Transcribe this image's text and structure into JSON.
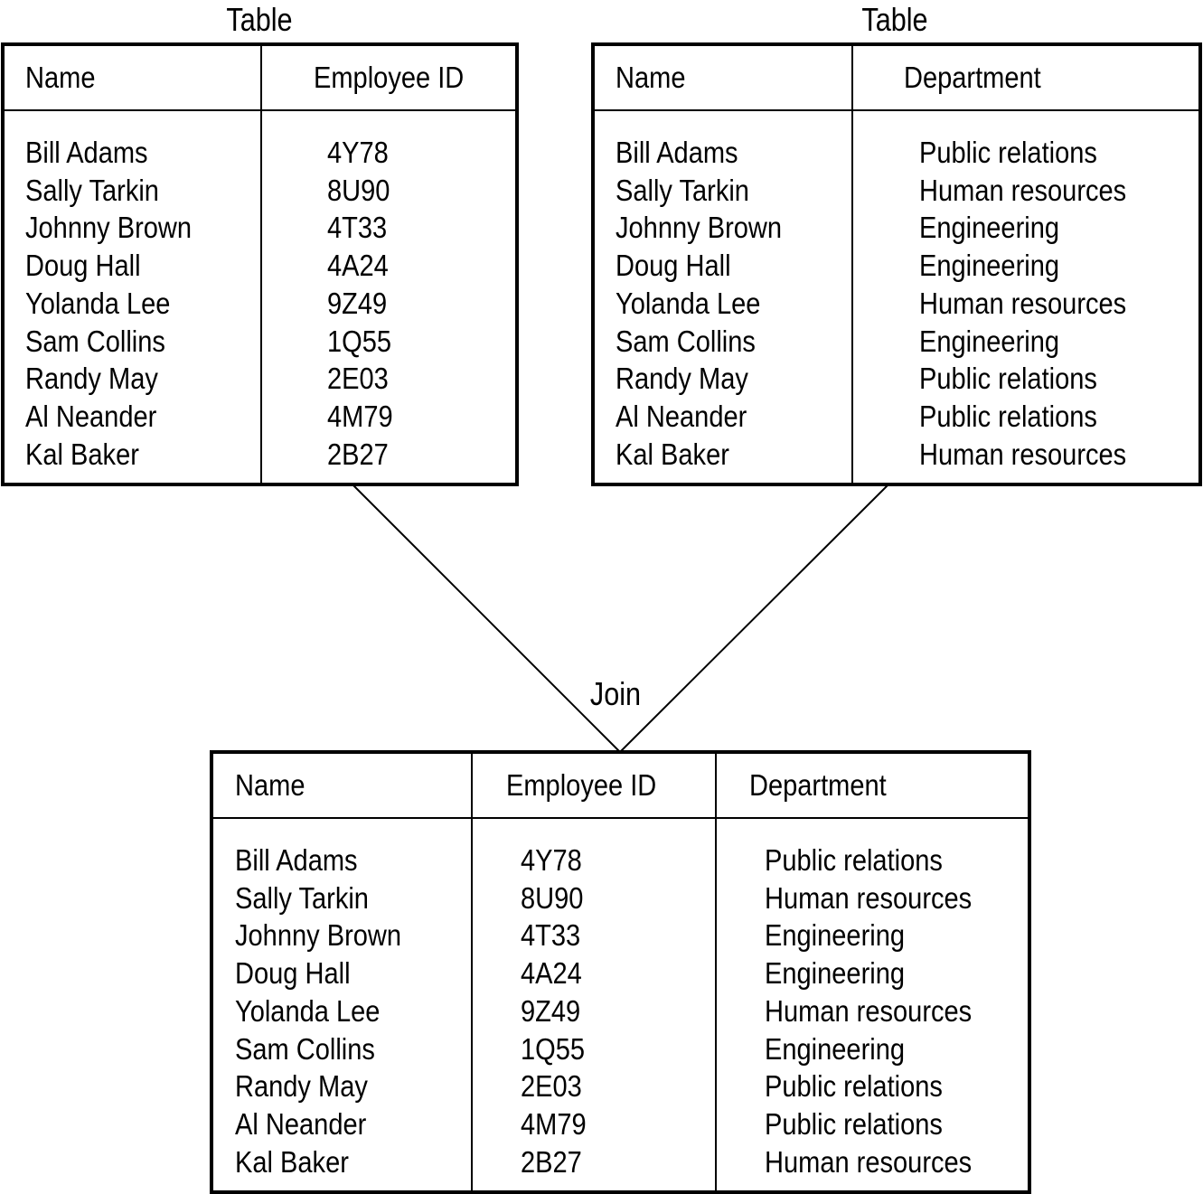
{
  "left_table": {
    "caption": "Table",
    "headers": [
      "Name",
      "Employee ID"
    ],
    "names": [
      "Bill Adams",
      "Sally Tarkin",
      "Johnny Brown",
      "Doug Hall",
      "Yolanda Lee",
      "Sam Collins",
      "Randy May",
      "Al Neander",
      "Kal Baker"
    ],
    "ids": [
      "4Y78",
      "8U90",
      "4T33",
      "4A24",
      "9Z49",
      "1Q55",
      "2E03",
      "4M79",
      "2B27"
    ]
  },
  "right_table": {
    "caption": "Table",
    "headers": [
      "Name",
      "Department"
    ],
    "names": [
      "Bill Adams",
      "Sally Tarkin",
      "Johnny Brown",
      "Doug Hall",
      "Yolanda Lee",
      "Sam Collins",
      "Randy May",
      "Al Neander",
      "Kal Baker"
    ],
    "departments": [
      "Public relations",
      "Human resources",
      "Engineering",
      "Engineering",
      "Human resources",
      "Engineering",
      "Public relations",
      "Public relations",
      "Human resources"
    ]
  },
  "join_label": "Join",
  "joined_table": {
    "headers": [
      "Name",
      "Employee ID",
      "Department"
    ],
    "names": [
      "Bill Adams",
      "Sally Tarkin",
      "Johnny Brown",
      "Doug Hall",
      "Yolanda Lee",
      "Sam Collins",
      "Randy May",
      "Al Neander",
      "Kal Baker"
    ],
    "ids": [
      "4Y78",
      "8U90",
      "4T33",
      "4A24",
      "9Z49",
      "1Q55",
      "2E03",
      "4M79",
      "2B27"
    ],
    "departments": [
      "Public relations",
      "Human resources",
      "Engineering",
      "Engineering",
      "Human resources",
      "Engineering",
      "Public relations",
      "Public relations",
      "Human resources"
    ]
  }
}
